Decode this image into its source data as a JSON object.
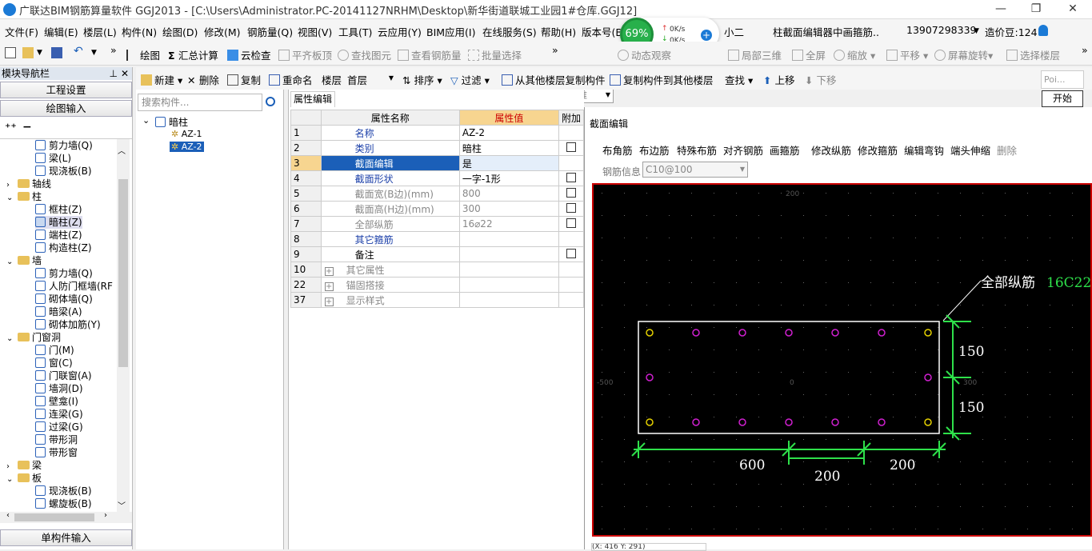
{
  "window": {
    "title": "广联达BIM钢筋算量软件 GGJ2013 - [C:\\Users\\Administrator.PC-20141127NRHM\\Desktop\\新华街道联城工业园1#仓库.GGJ12]",
    "minimize": "—",
    "restore": "❐",
    "close": "✕"
  },
  "menu": {
    "items": [
      "文件(F)",
      "编辑(E)",
      "楼层(L)",
      "构件(N)",
      "绘图(D)",
      "修改(M)",
      "钢筋量(Q)",
      "视图(V)",
      "工具(T)",
      "云应用(Y)",
      "BIM应用(I)",
      "在线服务(S)",
      "帮助(H)",
      "版本号(B)"
    ],
    "extra": "小二",
    "notice": "柱截面编辑器中画箍筋..",
    "phone": "13907298339",
    "beans": "造价豆:124"
  },
  "perf": {
    "cpu": "69%",
    "up": "0K/s",
    "down": "0K/s"
  },
  "toolbar": {
    "draw": "绘图",
    "sum": "汇总计算",
    "cloud_check": "云检查",
    "flush_slab": "平齐板顶",
    "find_elem": "查找图元",
    "view_rebar": "查看钢筋量",
    "batch_select": "批量选择",
    "view_mode": "二维",
    "dynamic_view": "动态观察",
    "local_3d": "局部三维",
    "fullscreen": "全屏",
    "zoom": "缩放",
    "pan": "平移",
    "rotate": "屏幕旋转",
    "select_floor": "选择楼层"
  },
  "toolbar2": {
    "new": "新建",
    "delete": "删除",
    "copy": "复制",
    "rename": "重命名",
    "floor_label": "楼层",
    "floor_value": "首层",
    "sort": "排序",
    "filter": "过滤",
    "copy_from": "从其他楼层复制构件",
    "copy_to": "复制构件到其他楼层",
    "find": "查找",
    "up": "上移",
    "down": "下移"
  },
  "float_panel": {
    "placeholder": "Poi...",
    "start": "开始"
  },
  "nav": {
    "title": "模块导航栏",
    "btn_project": "工程设置",
    "btn_draw_input": "绘图输入",
    "btn_single_input": "单构件输入",
    "tree": [
      {
        "label": "剪力墙(Q)",
        "indent": 2,
        "type": "item"
      },
      {
        "label": "梁(L)",
        "indent": 2,
        "type": "item"
      },
      {
        "label": "现浇板(B)",
        "indent": 2,
        "type": "item"
      },
      {
        "label": "轴线",
        "indent": 1,
        "type": "folder",
        "toggle": "›"
      },
      {
        "label": "柱",
        "indent": 1,
        "type": "folder",
        "toggle": "⌄"
      },
      {
        "label": "框柱(Z)",
        "indent": 2,
        "type": "item"
      },
      {
        "label": "暗柱(Z)",
        "indent": 2,
        "type": "item",
        "selected": true
      },
      {
        "label": "端柱(Z)",
        "indent": 2,
        "type": "item"
      },
      {
        "label": "构造柱(Z)",
        "indent": 2,
        "type": "item"
      },
      {
        "label": "墙",
        "indent": 1,
        "type": "folder",
        "toggle": "⌄"
      },
      {
        "label": "剪力墙(Q)",
        "indent": 2,
        "type": "item"
      },
      {
        "label": "人防门框墙(RF",
        "indent": 2,
        "type": "item"
      },
      {
        "label": "砌体墙(Q)",
        "indent": 2,
        "type": "item"
      },
      {
        "label": "暗梁(A)",
        "indent": 2,
        "type": "item"
      },
      {
        "label": "砌体加筋(Y)",
        "indent": 2,
        "type": "item"
      },
      {
        "label": "门窗洞",
        "indent": 1,
        "type": "folder",
        "toggle": "⌄"
      },
      {
        "label": "门(M)",
        "indent": 2,
        "type": "item"
      },
      {
        "label": "窗(C)",
        "indent": 2,
        "type": "item"
      },
      {
        "label": "门联窗(A)",
        "indent": 2,
        "type": "item"
      },
      {
        "label": "墙洞(D)",
        "indent": 2,
        "type": "item"
      },
      {
        "label": "壁龛(I)",
        "indent": 2,
        "type": "item"
      },
      {
        "label": "连梁(G)",
        "indent": 2,
        "type": "item"
      },
      {
        "label": "过梁(G)",
        "indent": 2,
        "type": "item"
      },
      {
        "label": "带形洞",
        "indent": 2,
        "type": "item"
      },
      {
        "label": "带形窗",
        "indent": 2,
        "type": "item"
      },
      {
        "label": "梁",
        "indent": 1,
        "type": "folder",
        "toggle": "›"
      },
      {
        "label": "板",
        "indent": 1,
        "type": "folder",
        "toggle": "⌄"
      },
      {
        "label": "现浇板(B)",
        "indent": 2,
        "type": "item"
      },
      {
        "label": "螺旋板(B)",
        "indent": 2,
        "type": "item"
      }
    ]
  },
  "complist": {
    "search_placeholder": "搜索构件...",
    "root": "暗柱",
    "items": [
      "AZ-1",
      "AZ-2"
    ],
    "selected": "AZ-2"
  },
  "props": {
    "tab": "属性编辑",
    "col_name": "属性名称",
    "col_value": "属性值",
    "col_extra": "附加",
    "rows": [
      {
        "no": "1",
        "name": "名称",
        "value": "AZ-2",
        "check": false,
        "blue": true
      },
      {
        "no": "2",
        "name": "类别",
        "value": "暗柱",
        "check": true,
        "blue": true
      },
      {
        "no": "3",
        "name": "截面编辑",
        "value": "是",
        "check": false,
        "blue": true,
        "selected": true
      },
      {
        "no": "4",
        "name": "截面形状",
        "value": "一字-1形",
        "check": true,
        "blue": true
      },
      {
        "no": "5",
        "name": "截面宽(B边)(mm)",
        "value": "800",
        "check": true,
        "gray": true
      },
      {
        "no": "6",
        "name": "截面高(H边)(mm)",
        "value": "300",
        "check": true,
        "gray": true
      },
      {
        "no": "7",
        "name": "全部纵筋",
        "value": "16⌀22",
        "check": true,
        "gray": true
      },
      {
        "no": "8",
        "name": "其它箍筋",
        "value": "",
        "check": false,
        "blue": true
      },
      {
        "no": "9",
        "name": "备注",
        "value": "",
        "check": true
      },
      {
        "no": "10",
        "name": "其它属性",
        "value": "",
        "check": false,
        "expand": true,
        "gray": true
      },
      {
        "no": "22",
        "name": "锚固搭接",
        "value": "",
        "check": false,
        "expand": true,
        "gray": true
      },
      {
        "no": "37",
        "name": "显示样式",
        "value": "",
        "check": false,
        "expand": true,
        "gray": true
      }
    ]
  },
  "section_editor": {
    "title": "截面编辑",
    "tools": [
      "布角筋",
      "布边筋",
      "特殊布筋",
      "对齐钢筋",
      "画箍筋",
      "修改纵筋",
      "修改箍筋",
      "编辑弯钩",
      "端头伸缩",
      "删除"
    ],
    "rebar_info_label": "钢筋信息",
    "rebar_info_value": "C10@100",
    "annotation_label": "全部纵筋",
    "annotation_value": "16C22",
    "dims": {
      "h1": "150",
      "h2": "150",
      "w1": "600",
      "w2": "200",
      "w3": "200"
    },
    "axis_labels": {
      "top": "200",
      "left": "-500",
      "right": "300",
      "center": "0"
    },
    "status": "(X: 416 Y: 291)"
  }
}
